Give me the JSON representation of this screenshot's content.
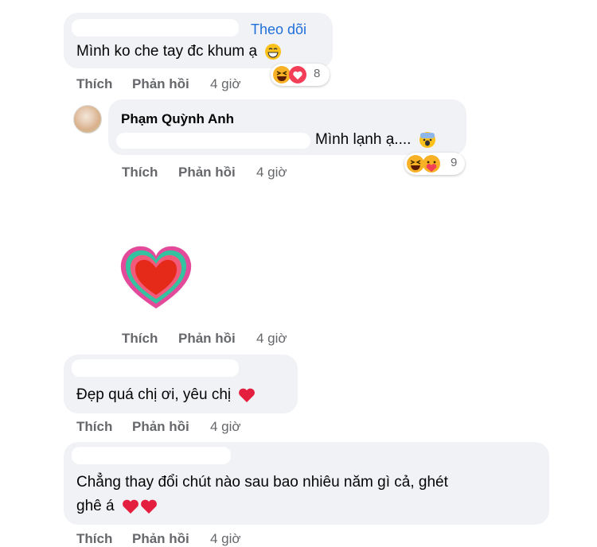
{
  "comments": [
    {
      "follow_label": "Theo dõi",
      "text": "Mình ko che tay đc khum ạ",
      "reaction_count": "8",
      "actions": {
        "like": "Thích",
        "reply": "Phản hồi",
        "time": "4 giờ"
      }
    },
    {
      "author": "Phạm Quỳnh Anh",
      "text": "Mình lạnh ạ....",
      "reaction_count": "9",
      "actions": {
        "like": "Thích",
        "reply": "Phản hồi",
        "time": "4 giờ"
      }
    },
    {
      "sticker": "heart-sticker",
      "actions": {
        "like": "Thích",
        "reply": "Phản hồi",
        "time": "4 giờ"
      }
    },
    {
      "text": "Đẹp quá chị ơi, yêu chị",
      "actions": {
        "like": "Thích",
        "reply": "Phản hồi",
        "time": "4 giờ"
      }
    },
    {
      "text_line1": "Chẳng thay đổi chút nào sau bao nhiêu năm gì cả, ghét",
      "text_line2": "ghê á",
      "actions": {
        "like": "Thích",
        "reply": "Phản hồi",
        "time": "4 giờ"
      }
    }
  ],
  "colors": {
    "link": "#216fdb",
    "bubble": "#f0f2f5",
    "meta": "#65676b",
    "heart": "#e41e3f"
  }
}
